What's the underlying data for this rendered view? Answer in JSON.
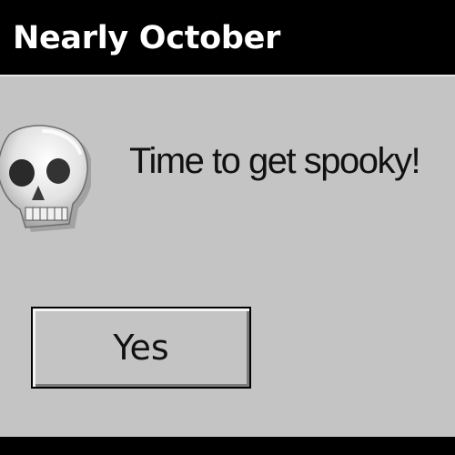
{
  "window": {
    "title": "Nearly October"
  },
  "message": {
    "text": "Time to get spooky!",
    "icon": "skull-icon"
  },
  "buttons": {
    "yes_label": "Yes"
  },
  "colors": {
    "title_bar": "#000000",
    "title_text": "#ffffff",
    "dialog_face": "#c4c4c4",
    "text": "#111111"
  }
}
